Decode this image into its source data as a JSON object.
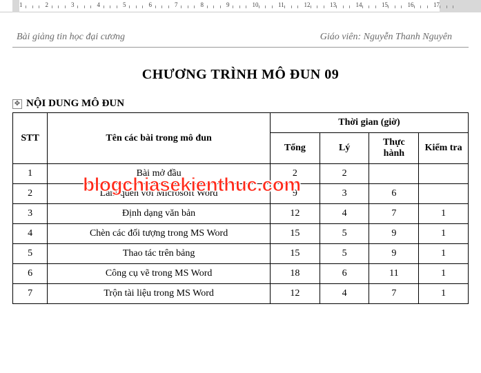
{
  "ruler": {
    "marks": [
      "1",
      "2",
      "3",
      "4",
      "5",
      "6",
      "7",
      "8",
      "9",
      "10",
      "11",
      "12",
      "13",
      "14",
      "15",
      "16",
      "17"
    ]
  },
  "header": {
    "left": "Bài giảng tin học đại cương",
    "right": "Giáo viên: Nguyễn Thanh Nguyên"
  },
  "title": "CHƯƠNG TRÌNH MÔ ĐUN 09",
  "section_title": "NỘI DUNG MÔ ĐUN",
  "move_handle_glyph": "✥",
  "table": {
    "headers": {
      "stt": "STT",
      "name": "Tên các bài trong mô đun",
      "time_group": "Thời gian (giờ)",
      "total": "Tổng",
      "theory": "Lý",
      "practice": "Thực hành",
      "exam": "Kiểm tra"
    },
    "rows": [
      {
        "stt": "1",
        "name": "Bài mở đầu",
        "total": "2",
        "theory": "2",
        "practice": "",
        "exam": ""
      },
      {
        "stt": "2",
        "name": "Làm quen với Microsoft Word",
        "total": "9",
        "theory": "3",
        "practice": "6",
        "exam": ""
      },
      {
        "stt": "3",
        "name": "Định dạng văn bản",
        "total": "12",
        "theory": "4",
        "practice": "7",
        "exam": "1"
      },
      {
        "stt": "4",
        "name": "Chèn các đối tượng trong MS Word",
        "total": "15",
        "theory": "5",
        "practice": "9",
        "exam": "1"
      },
      {
        "stt": "5",
        "name": "Thao tác trên bảng",
        "total": "15",
        "theory": "5",
        "practice": "9",
        "exam": "1"
      },
      {
        "stt": "6",
        "name": "Công cụ vẽ trong MS Word",
        "total": "18",
        "theory": "6",
        "practice": "11",
        "exam": "1"
      },
      {
        "stt": "7",
        "name": "Trộn tài liệu trong MS Word",
        "total": "12",
        "theory": "4",
        "practice": "7",
        "exam": "1"
      }
    ]
  },
  "watermark": "blogchiasekienthuc.com"
}
